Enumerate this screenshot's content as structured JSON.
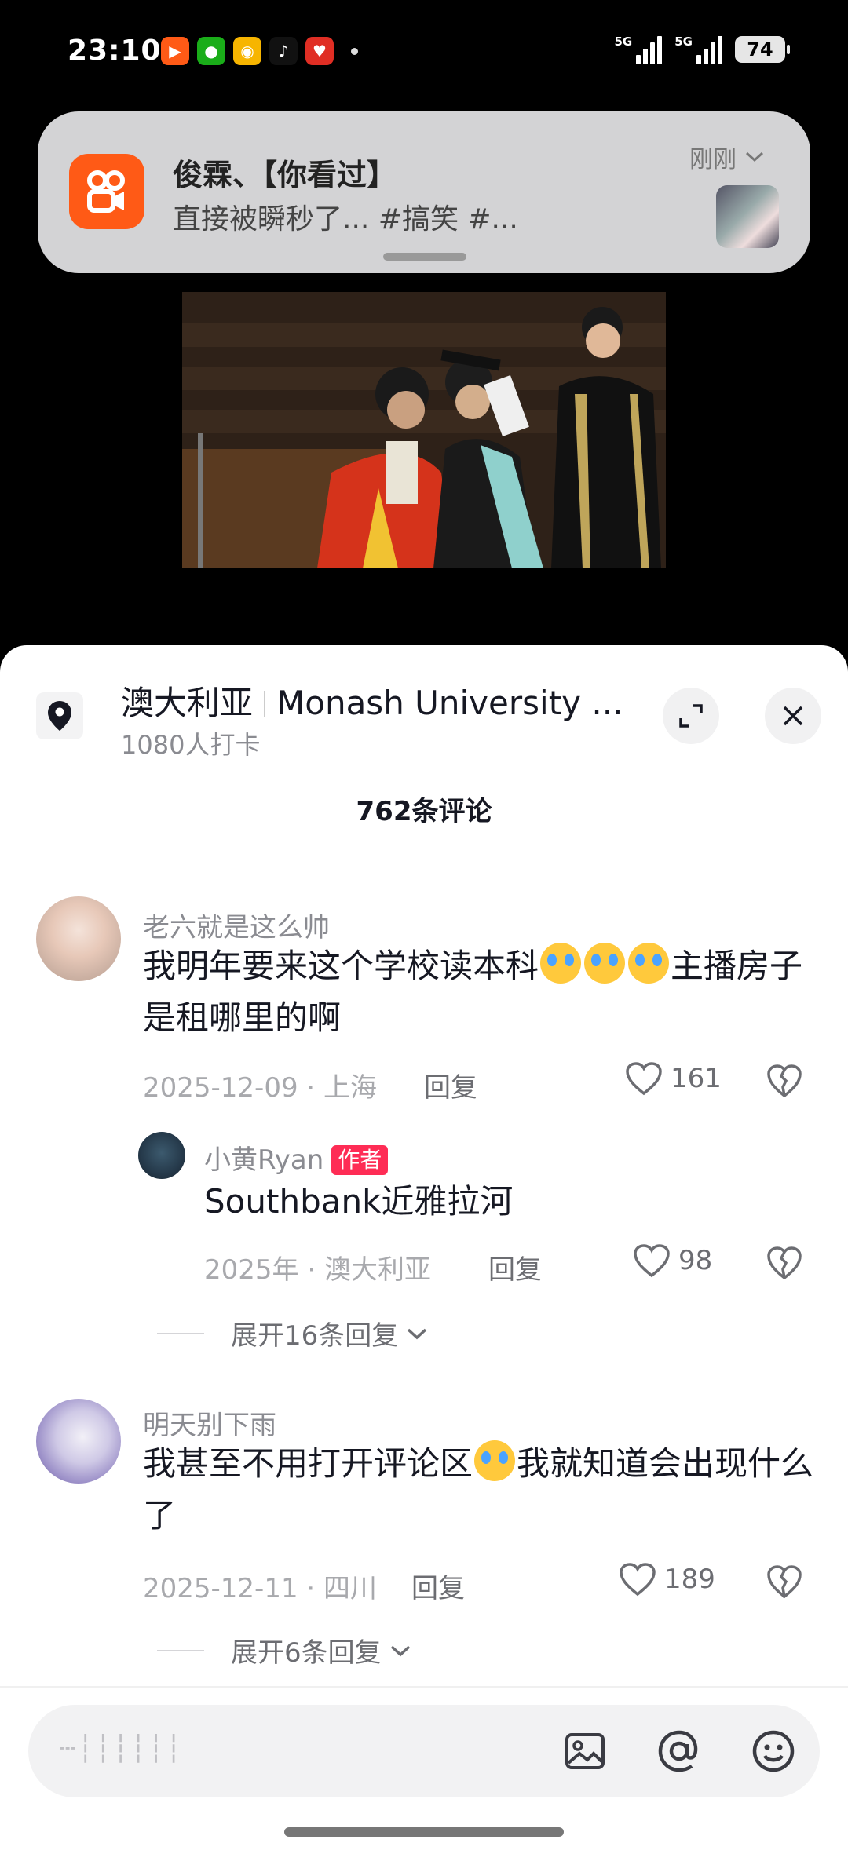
{
  "status_bar": {
    "time": "23:10",
    "network_1": "5G",
    "network_2": "5G",
    "battery": "74"
  },
  "notification": {
    "title": "俊霖、【你看过】",
    "body": "直接被瞬秒了... #搞笑 #...",
    "time": "刚刚"
  },
  "location": {
    "name": "澳大利亚",
    "detail": "Monash University ...",
    "checkins": "1080人打卡"
  },
  "comments_header": {
    "count": "762条评论"
  },
  "comments": [
    {
      "user": "老六就是这么帅",
      "text_part1": "我明年要来这个学校读本科",
      "text_part2": "主播房子是租哪里的啊",
      "date_location": "2025-12-09 · 上海",
      "reply_label": "回复",
      "likes": "161"
    },
    {
      "user": "小黄Ryan",
      "badge": "作者",
      "text": "Southbank近雅拉河",
      "date_location": "2025年 · 澳大利亚",
      "reply_label": "回复",
      "likes": "98"
    },
    {
      "user": "明天别下雨",
      "text_part1": "我甚至不用打开评论区",
      "text_part2": "我就知道会出现什么了",
      "date_location": "2025-12-11 · 四川",
      "reply_label": "回复",
      "likes": "189"
    }
  ],
  "expand_replies": [
    "展开16条回复",
    "展开6条回复"
  ],
  "input": {
    "placeholder": "┄┆┆┆┆┆┆"
  },
  "colors": {
    "accent": "#fe2c55",
    "kuaishou": "#ff5a16"
  }
}
